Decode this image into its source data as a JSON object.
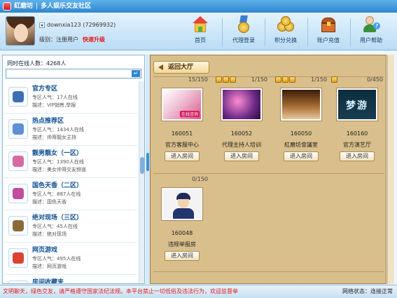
{
  "window": {
    "app_name": "紅磨坊",
    "separator": "|",
    "subtitle": "多人娱乐交友社区"
  },
  "user": {
    "username": "downxia123 (72969932)",
    "level_label": "级别：注册用户",
    "upgrade_label": "快速升级"
  },
  "nav": [
    {
      "label": "首页",
      "icon": "home-icon"
    },
    {
      "label": "代理登录",
      "icon": "medal-icon"
    },
    {
      "label": "积分兑换",
      "icon": "coins-icon"
    },
    {
      "label": "账户充值",
      "icon": "treasure-chest-icon"
    },
    {
      "label": "用户帮助",
      "icon": "help-user-icon"
    }
  ],
  "left": {
    "online_text": "同时在线人数：4268人",
    "search_placeholder": "",
    "categories": [
      {
        "title": "官方专区",
        "popularity": "专区人气：17人在线",
        "desc": "描述：VIP销售,举报",
        "icon": "official-icon",
        "color": "#3d6fb5"
      },
      {
        "title": "热点推荐区",
        "popularity": "专区人气：1434人在线",
        "desc": "描述：帅哥靓女主持",
        "icon": "hot-recommend-icon",
        "color": "#5c8fd6"
      },
      {
        "title": "靓男靓女（一区）",
        "popularity": "专区人气：1390人在线",
        "desc": "描述：美女帅哥交友频道",
        "icon": "couple-icon",
        "color": "#d86aa3"
      },
      {
        "title": "国色天香（二区）",
        "popularity": "专区人气：887人在线",
        "desc": "描述：国色天香",
        "icon": "beauty-icon",
        "color": "#c14ea1"
      },
      {
        "title": "绝对现场（三区）",
        "popularity": "专区人气：45人在线",
        "desc": "描述：绝对现场",
        "icon": "live-tv-icon",
        "color": "#8b6a3a"
      },
      {
        "title": "网页游戏",
        "popularity": "专区人气：495人在线",
        "desc": "描述：网页游戏",
        "icon": "web-game-icon",
        "color": "#d9432f"
      },
      {
        "title": "房间收藏夹",
        "popularity": "",
        "desc": "",
        "icon": "favorites-icon",
        "color": "#c7302a"
      }
    ]
  },
  "right": {
    "back_label": "返回大厅",
    "rooms": [
      {
        "count": "15/150",
        "id": "160051",
        "name": "官方客服中心",
        "enter": "进入房间",
        "badges": 0,
        "thumb_tag": "在线咨询"
      },
      {
        "count": "1/150",
        "id": "160052",
        "name": "代理主持人培训",
        "enter": "进入房间",
        "badges": 3,
        "thumb_tag": ""
      },
      {
        "count": "1/150",
        "id": "160050",
        "name": "紅磨坊會議室",
        "enter": "进入房间",
        "badges": 3,
        "thumb_tag": ""
      },
      {
        "count": "0/450",
        "id": "160160",
        "name": "官方演艺厅",
        "enter": "进入房间",
        "badges": 1,
        "thumb_tag": "梦游"
      },
      {
        "count": "0/150",
        "id": "160048",
        "name": "违规举报房",
        "enter": "进入房间",
        "badges": 0,
        "thumb_tag": ""
      }
    ]
  },
  "status": {
    "notice": "文明聊天，绿色交友，请严格遵守国家法纪法规。本平台禁止一切低俗及违法行为，欢迎监督举",
    "network": "网络状态：连接正常"
  }
}
